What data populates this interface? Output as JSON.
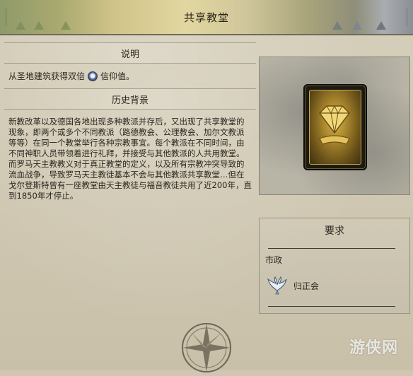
{
  "window": {
    "title": "共享教堂"
  },
  "description": {
    "header": "说明",
    "text_before": "从圣地建筑获得双倍",
    "icon": "faith-icon",
    "text_after": "信仰值。"
  },
  "history": {
    "header": "历史背景",
    "text": "新教改革以及德国各地出现多种教派并存后，又出现了共享教堂的现象，即两个或多个不同教派（路德教会、公理教会、加尔文教派等等）在同一个教堂举行各种宗教事宜。每个教派在不同时间，由不同神职人员带领着进行礼拜，并接受与其他教派的人共用教堂。而罗马天主教教义对于真正教堂的定义，以及所有宗教冲突导致的流血战争，导致罗马天主教徒基本不会与其他教派共享教堂…但在戈尔登斯特曾有一座教堂由天主教徒与福音教徒共用了近200年，直到1850年才停止。"
  },
  "card": {
    "icon": "diamond-gem-icon"
  },
  "requirements": {
    "header": "要求",
    "civic_label": "市政",
    "civic_name": "归正会",
    "civic_icon": "winged-dove-icon"
  },
  "watermark": {
    "text": "游侠网"
  },
  "colors": {
    "accent_gold": "#c9a94c",
    "panel_bg": "#cfc7b2",
    "text": "#2b2720"
  }
}
